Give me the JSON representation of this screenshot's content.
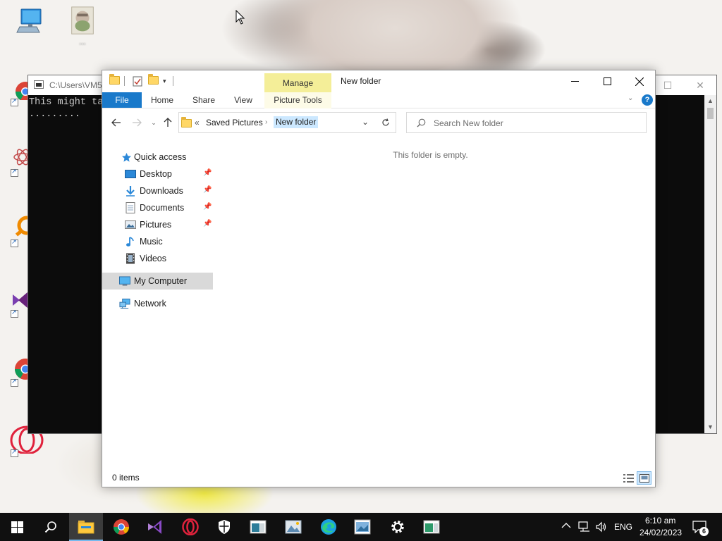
{
  "desktop": {
    "icons": [
      {
        "name": "this-pc-icon",
        "label": ""
      },
      {
        "name": "user-photo-icon",
        "label": "..."
      }
    ]
  },
  "console": {
    "title": "C:\\Users\\VM5\\",
    "lines": [
      "This might ta",
      "........."
    ]
  },
  "explorer": {
    "title": "New folder",
    "manage_tab": "Manage",
    "ribbon_tabs": {
      "file": "File",
      "home": "Home",
      "share": "Share",
      "view": "View",
      "picture_tools": "Picture Tools"
    },
    "address": {
      "overflow": "«",
      "crumbs": [
        "Saved Pictures",
        "New folder"
      ]
    },
    "search": {
      "placeholder": "Search New folder"
    },
    "nav": {
      "quick_access": "Quick access",
      "items": [
        "Desktop",
        "Downloads",
        "Documents",
        "Pictures",
        "Music",
        "Videos"
      ],
      "my_computer": "My Computer",
      "network": "Network"
    },
    "empty_message": "This folder is empty.",
    "status": {
      "item_count": "0 items"
    }
  },
  "taskbar": {
    "apps": [
      "start-icon",
      "search-icon",
      "file-explorer-icon",
      "chrome-icon",
      "visual-studio-icon",
      "opera-icon",
      "defender-icon",
      "console-app-icon",
      "photos-icon",
      "edge-icon",
      "paint-icon",
      "settings-icon",
      "console-app-2-icon"
    ],
    "language": "ENG",
    "time": "6:10 am",
    "date": "24/02/2023",
    "notification_count": "6"
  },
  "colors": {
    "ribbon_file": "#1979ca",
    "manage_tab": "#f4ee98",
    "selection": "#cce8ff",
    "taskbar": "#101010",
    "taskbar_accent": "#76b9ed"
  }
}
